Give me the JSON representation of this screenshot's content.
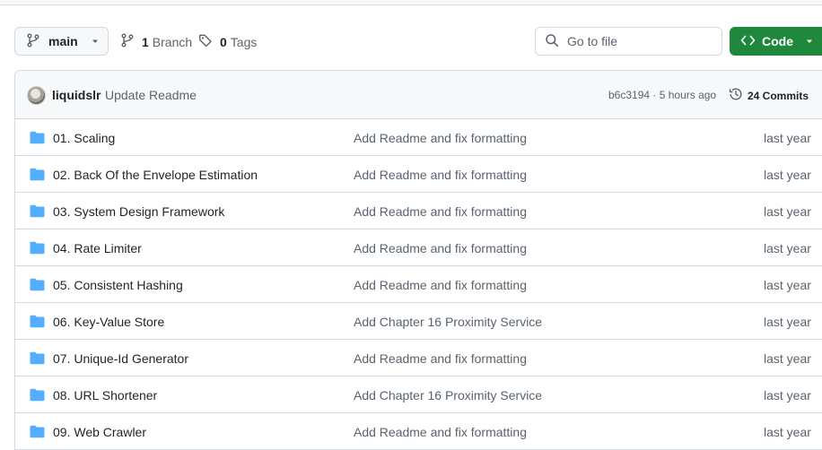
{
  "toolbar": {
    "branch_label": "main",
    "branches_count": "1",
    "branches_label": "Branch",
    "tags_count": "0",
    "tags_label": "Tags",
    "goto_placeholder": "Go to file",
    "code_label": "Code"
  },
  "commit": {
    "author": "liquidslr",
    "message": "Update Readme",
    "hash_time": "b6c3194 · 5 hours ago",
    "commits_label": "24 Commits"
  },
  "files": [
    {
      "name": "01. Scaling",
      "message": "Add Readme and fix formatting",
      "date": "last year"
    },
    {
      "name": "02. Back Of the Envelope Estimation",
      "message": "Add Readme and fix formatting",
      "date": "last year"
    },
    {
      "name": "03. System Design Framework",
      "message": "Add Readme and fix formatting",
      "date": "last year"
    },
    {
      "name": "04. Rate Limiter",
      "message": "Add Readme and fix formatting",
      "date": "last year"
    },
    {
      "name": "05. Consistent Hashing",
      "message": "Add Readme and fix formatting",
      "date": "last year"
    },
    {
      "name": "06. Key-Value Store",
      "message": "Add Chapter 16 Proximity Service",
      "date": "last year"
    },
    {
      "name": "07. Unique-Id Generator",
      "message": "Add Readme and fix formatting",
      "date": "last year"
    },
    {
      "name": "08. URL Shortener",
      "message": "Add Chapter 16 Proximity Service",
      "date": "last year"
    },
    {
      "name": "09. Web Crawler",
      "message": "Add Readme and fix formatting",
      "date": "last year"
    }
  ],
  "colors": {
    "folder": "#54aeff",
    "accent_green": "#1f883d",
    "muted_text": "#59636e",
    "border": "#d1d9e0"
  },
  "icons": [
    "git-branch-icon",
    "caret-down-icon",
    "tag-icon",
    "search-icon",
    "code-icon",
    "history-icon",
    "folder-icon"
  ]
}
